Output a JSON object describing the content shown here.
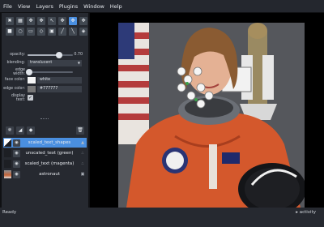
{
  "menu": [
    "File",
    "View",
    "Layers",
    "Plugins",
    "Window",
    "Help"
  ],
  "tools": {
    "row1": [
      "✖",
      "▦",
      "✥",
      "✥",
      "↖",
      "✥",
      "✥",
      "✥"
    ],
    "row2": [
      "■",
      "○",
      "▭",
      "◇",
      "▣",
      "╱",
      "╲",
      "◈"
    ]
  },
  "props": {
    "opacity_label": "opacity:",
    "opacity_value": "0.70",
    "blending_label": "blending:",
    "blending_value": "translucent",
    "edge_width_label": "edge width:",
    "face_color_label": "face color:",
    "face_color_value": "white",
    "edge_color_label": "edge color:",
    "edge_color_value": "#777777",
    "display_text_label": "display text:",
    "display_text_checked": "✓"
  },
  "layer_buttons": [
    "✵",
    "◢",
    "◆",
    "🗑"
  ],
  "layers": [
    {
      "name": "scaled_text_shapes",
      "eye": "◉",
      "type": "▲"
    },
    {
      "name": "unscaled_text (green)",
      "eye": "◉",
      "type": "∴"
    },
    {
      "name": "scaled_text (magenta)",
      "eye": "◉",
      "type": "∴"
    },
    {
      "name": "astronaut",
      "eye": "◉",
      "type": "▣"
    }
  ],
  "bottom_tools": [
    ">_",
    "▣",
    "□",
    "↺",
    "▦",
    "⌂"
  ],
  "status": {
    "left": "Ready",
    "right": "▸ activity"
  },
  "colors": {
    "accent": "#4a8fe0",
    "panel": "#262930",
    "face": "#f5f5f5",
    "edge": "#777777"
  }
}
